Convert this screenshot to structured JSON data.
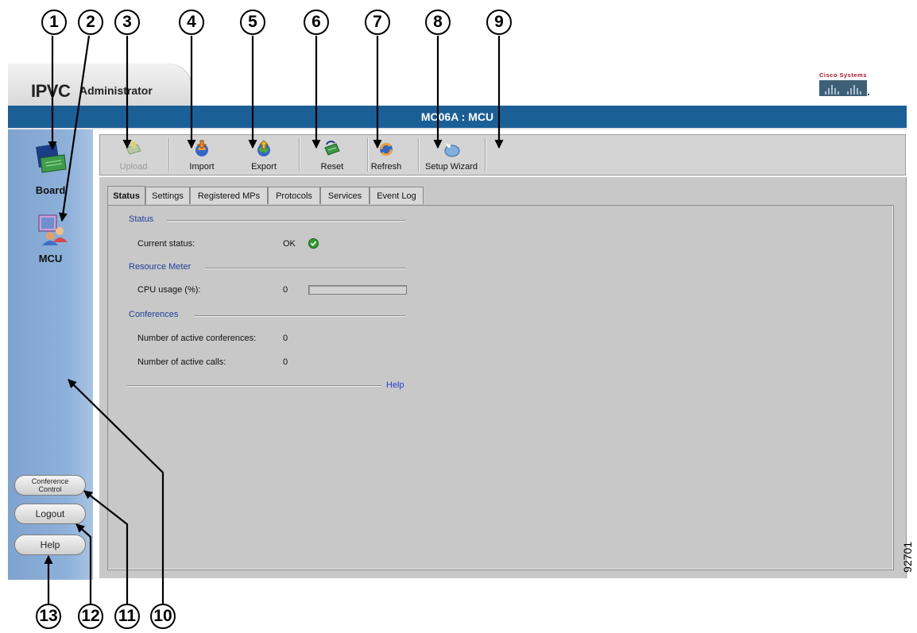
{
  "app": {
    "title_main": "IPVC",
    "title_sub": "Administrator",
    "vendor_logo": "Cisco Systems",
    "window_title": "MC06A : MCU"
  },
  "sidebar": {
    "items": [
      {
        "label": "Board",
        "icon": "board-icon"
      },
      {
        "label": "MCU",
        "icon": "mcu-icon"
      }
    ],
    "buttons": {
      "conference_control_line1": "Conference",
      "conference_control_line2": "Control",
      "logout": "Logout",
      "help": "Help"
    }
  },
  "toolbar": {
    "buttons": [
      {
        "label": "Upload",
        "icon": "upload-icon",
        "enabled": false
      },
      {
        "label": "Import",
        "icon": "import-icon",
        "enabled": true
      },
      {
        "label": "Export",
        "icon": "export-icon",
        "enabled": true
      },
      {
        "label": "Reset",
        "icon": "reset-icon",
        "enabled": true
      },
      {
        "label": "Refresh",
        "icon": "refresh-icon",
        "enabled": true
      },
      {
        "label": "Setup Wizard",
        "icon": "setup-wizard-icon",
        "enabled": true
      }
    ]
  },
  "tabs": [
    {
      "label": "Status",
      "active": true
    },
    {
      "label": "Settings",
      "active": false
    },
    {
      "label": "Registered MPs",
      "active": false
    },
    {
      "label": "Protocols",
      "active": false
    },
    {
      "label": "Services",
      "active": false
    },
    {
      "label": "Event Log",
      "active": false
    }
  ],
  "status_panel": {
    "status_section": "Status",
    "current_status_label": "Current status:",
    "current_status_value": "OK",
    "resource_section": "Resource Meter",
    "cpu_label": "CPU usage (%):",
    "cpu_value": "0",
    "cpu_fraction": 0,
    "conferences_section": "Conferences",
    "active_conferences_label": "Number of active conferences:",
    "active_conferences_value": "0",
    "active_calls_label": "Number of active calls:",
    "active_calls_value": "0",
    "help_link": "Help"
  },
  "callouts": [
    "1",
    "2",
    "3",
    "4",
    "5",
    "6",
    "7",
    "8",
    "9",
    "10",
    "11",
    "12",
    "13"
  ],
  "figure_id": "92701",
  "colors": {
    "title_bar": "#1b5f97",
    "sidebar": "#8eb1da",
    "content_bg": "#c8c8c8",
    "section_text": "#1f3f9a",
    "link": "#2b3ccf",
    "ok_check": "#2e9e2e"
  }
}
